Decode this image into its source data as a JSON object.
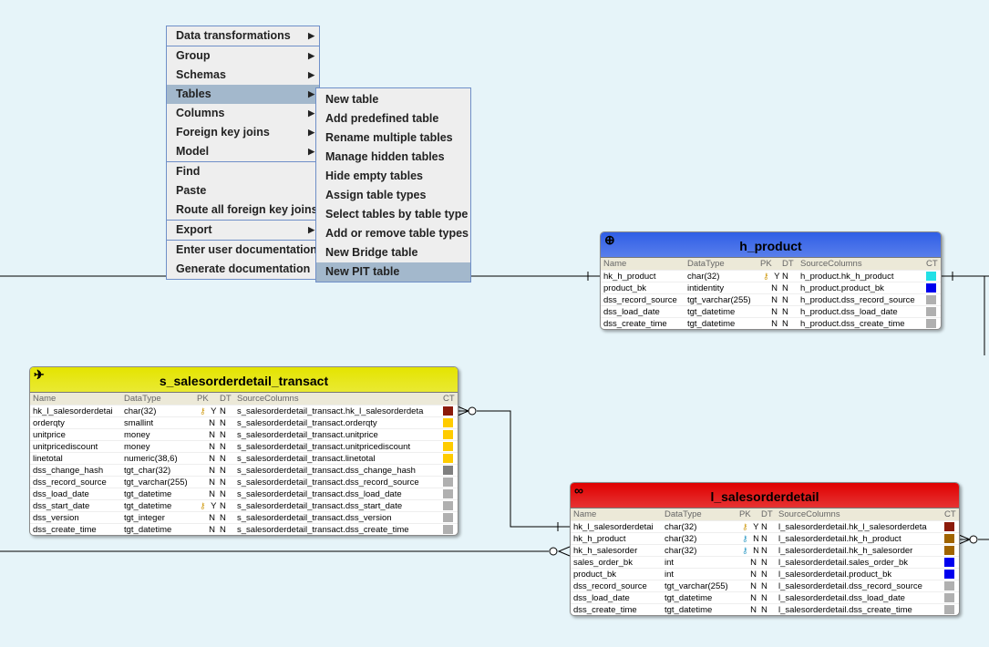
{
  "context_menu": {
    "groups": [
      [
        {
          "label": "Data transformations",
          "submenu": true
        }
      ],
      [
        {
          "label": "Group",
          "submenu": true
        },
        {
          "label": "Schemas",
          "submenu": true
        },
        {
          "label": "Tables",
          "submenu": true,
          "highlighted": true
        },
        {
          "label": "Columns",
          "submenu": true
        },
        {
          "label": "Foreign key joins",
          "submenu": true
        },
        {
          "label": "Model",
          "submenu": true
        }
      ],
      [
        {
          "label": "Find"
        },
        {
          "label": "Paste"
        },
        {
          "label": "Route all foreign key joins"
        }
      ],
      [
        {
          "label": "Export",
          "submenu": true
        }
      ],
      [
        {
          "label": "Enter user documentation"
        },
        {
          "label": "Generate documentation"
        }
      ]
    ]
  },
  "tables_submenu": {
    "items": [
      {
        "label": "New table"
      },
      {
        "label": "Add predefined table"
      },
      {
        "label": "Rename multiple tables"
      },
      {
        "label": "Manage hidden tables"
      },
      {
        "label": "Hide empty tables"
      },
      {
        "label": "Assign table types"
      },
      {
        "label": "Select tables by table type"
      },
      {
        "label": "Add or remove table types"
      },
      {
        "label": "New Bridge table"
      },
      {
        "label": "New PIT table",
        "highlighted": true
      }
    ]
  },
  "columns": [
    "Name",
    "DataType",
    "PK",
    "DT",
    "SourceColumns",
    "CT"
  ],
  "tables": [
    {
      "id": "h_product",
      "title": "h_product",
      "icon": "globe-icon",
      "header_color": "#2f5ee6",
      "rows": [
        [
          "hk_h_product",
          "char(32)",
          "Y",
          "N",
          "h_product.hk_h_product",
          "#22e0e6",
          "pk"
        ],
        [
          "product_bk",
          "intidentity",
          "N",
          "N",
          "h_product.product_bk",
          "#0000ee",
          ""
        ],
        [
          "dss_record_source",
          "tgt_varchar(255)",
          "N",
          "N",
          "h_product.dss_record_source",
          "#b0b0b0",
          ""
        ],
        [
          "dss_load_date",
          "tgt_datetime",
          "N",
          "N",
          "h_product.dss_load_date",
          "#b0b0b0",
          ""
        ],
        [
          "dss_create_time",
          "tgt_datetime",
          "N",
          "N",
          "h_product.dss_create_time",
          "#b0b0b0",
          ""
        ]
      ]
    },
    {
      "id": "s_salesorderdetail_transact",
      "title": "s_salesorderdetail_transact",
      "icon": "satellite-icon",
      "header_color": "#e4e400",
      "rows": [
        [
          "hk_l_salesorderdetai",
          "char(32)",
          "Y",
          "N",
          "s_salesorderdetail_transact.hk_l_salesorderdeta",
          "#8b1a0a",
          "pk"
        ],
        [
          "orderqty",
          "smallint",
          "N",
          "N",
          "s_salesorderdetail_transact.orderqty",
          "#ffcc00",
          ""
        ],
        [
          "unitprice",
          "money",
          "N",
          "N",
          "s_salesorderdetail_transact.unitprice",
          "#ffcc00",
          ""
        ],
        [
          "unitpricediscount",
          "money",
          "N",
          "N",
          "s_salesorderdetail_transact.unitpricediscount",
          "#ffcc00",
          ""
        ],
        [
          "linetotal",
          "numeric(38,6)",
          "N",
          "N",
          "s_salesorderdetail_transact.linetotal",
          "#ffcc00",
          ""
        ],
        [
          "dss_change_hash",
          "tgt_char(32)",
          "N",
          "N",
          "s_salesorderdetail_transact.dss_change_hash",
          "#808080",
          ""
        ],
        [
          "dss_record_source",
          "tgt_varchar(255)",
          "N",
          "N",
          "s_salesorderdetail_transact.dss_record_source",
          "#b0b0b0",
          ""
        ],
        [
          "dss_load_date",
          "tgt_datetime",
          "N",
          "N",
          "s_salesorderdetail_transact.dss_load_date",
          "#b0b0b0",
          ""
        ],
        [
          "dss_start_date",
          "tgt_datetime",
          "Y",
          "N",
          "s_salesorderdetail_transact.dss_start_date",
          "#b0b0b0",
          "pk"
        ],
        [
          "dss_version",
          "tgt_integer",
          "N",
          "N",
          "s_salesorderdetail_transact.dss_version",
          "#b0b0b0",
          ""
        ],
        [
          "dss_create_time",
          "tgt_datetime",
          "N",
          "N",
          "s_salesorderdetail_transact.dss_create_time",
          "#b0b0b0",
          ""
        ]
      ]
    },
    {
      "id": "l_salesorderdetail",
      "title": "l_salesorderdetail",
      "icon": "link-icon",
      "header_color": "#e00000",
      "rows": [
        [
          "hk_l_salesorderdetai",
          "char(32)",
          "Y",
          "N",
          "l_salesorderdetail.hk_l_salesorderdeta",
          "#8b1a0a",
          "pk"
        ],
        [
          "hk_h_product",
          "char(32)",
          "N",
          "N",
          "l_salesorderdetail.hk_h_product",
          "#a06400",
          "fk"
        ],
        [
          "hk_h_salesorder",
          "char(32)",
          "N",
          "N",
          "l_salesorderdetail.hk_h_salesorder",
          "#a06400",
          "fk"
        ],
        [
          "sales_order_bk",
          "int",
          "N",
          "N",
          "l_salesorderdetail.sales_order_bk",
          "#0000ee",
          ""
        ],
        [
          "product_bk",
          "int",
          "N",
          "N",
          "l_salesorderdetail.product_bk",
          "#0000ee",
          ""
        ],
        [
          "dss_record_source",
          "tgt_varchar(255)",
          "N",
          "N",
          "l_salesorderdetail.dss_record_source",
          "#b0b0b0",
          ""
        ],
        [
          "dss_load_date",
          "tgt_datetime",
          "N",
          "N",
          "l_salesorderdetail.dss_load_date",
          "#b0b0b0",
          ""
        ],
        [
          "dss_create_time",
          "tgt_datetime",
          "N",
          "N",
          "l_salesorderdetail.dss_create_time",
          "#b0b0b0",
          ""
        ]
      ]
    }
  ]
}
